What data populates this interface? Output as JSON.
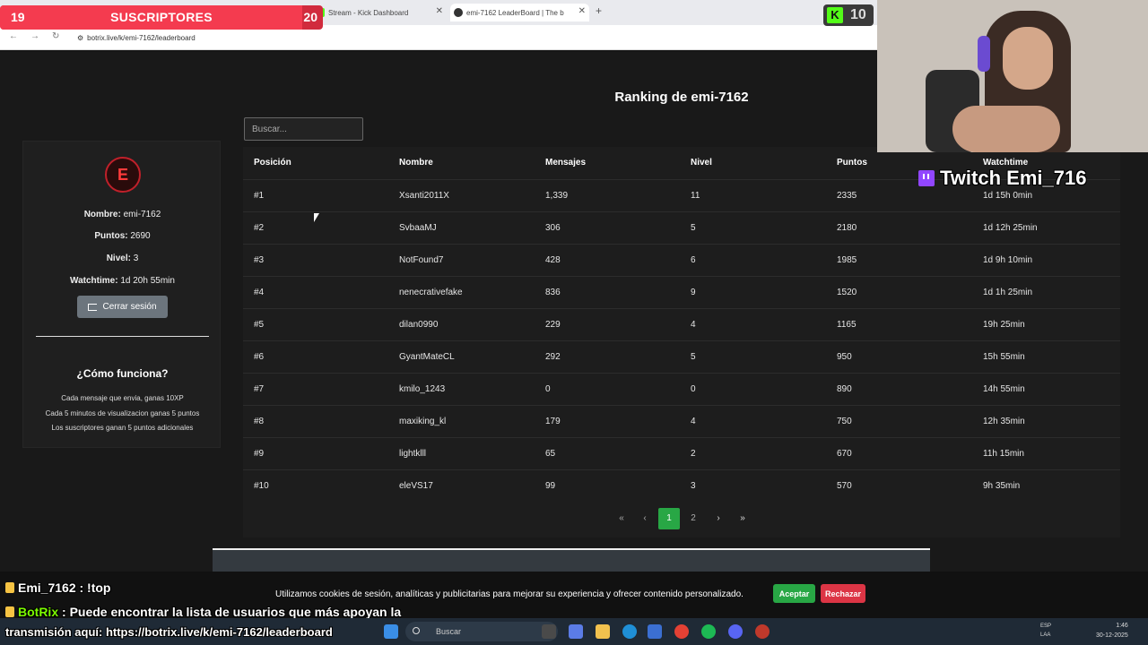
{
  "browser": {
    "tabs": [
      {
        "label": "Stream - Kick Dashboard"
      },
      {
        "label": "emi-7162 LeaderBoard | The b"
      }
    ],
    "url": "botrix.live/k/emi-7162/leaderboard",
    "new_tab": "+"
  },
  "overlay": {
    "subs_left": "19",
    "subs_title": "SUSCRIPTORES",
    "subs_right": "20",
    "kick_letter": "K",
    "kick_count": "10",
    "twitch_label": "Twitch Emi_716"
  },
  "page": {
    "title": "Ranking de emi-7162",
    "search_placeholder": "Buscar..."
  },
  "profile": {
    "avatar_letter": "E",
    "name_label": "Nombre:",
    "name_value": "emi-7162",
    "points_label": "Puntos:",
    "points_value": "2690",
    "level_label": "Nivel:",
    "level_value": "3",
    "watch_label": "Watchtime:",
    "watch_value": "1d 20h 55min",
    "logout_label": "Cerrar sesión",
    "how_title": "¿Cómo funciona?",
    "how_lines": [
      "Cada mensaje que envia, ganas 10XP",
      "Cada 5 minutos de visualizacion ganas 5 puntos",
      "Los suscriptores ganan 5 puntos adicionales"
    ]
  },
  "table": {
    "headers": [
      "Posición",
      "Nombre",
      "Mensajes",
      "Nivel",
      "Puntos",
      "Watchtime"
    ],
    "rows": [
      [
        "#1",
        "Xsanti2011X",
        "1,339",
        "11",
        "2335",
        "1d 15h 0min"
      ],
      [
        "#2",
        "SvbaaMJ",
        "306",
        "5",
        "2180",
        "1d 12h 25min"
      ],
      [
        "#3",
        "NotFound7",
        "428",
        "6",
        "1985",
        "1d 9h 10min"
      ],
      [
        "#4",
        "nenecrativefake",
        "836",
        "9",
        "1520",
        "1d 1h 25min"
      ],
      [
        "#5",
        "dilan0990",
        "229",
        "4",
        "1165",
        "19h 25min"
      ],
      [
        "#6",
        "GyantMateCL",
        "292",
        "5",
        "950",
        "15h 55min"
      ],
      [
        "#7",
        "kmilo_1243",
        "0",
        "0",
        "890",
        "14h 55min"
      ],
      [
        "#8",
        "maxiking_kl",
        "179",
        "4",
        "750",
        "12h 35min"
      ],
      [
        "#9",
        "lightklll",
        "65",
        "2",
        "670",
        "11h 15min"
      ],
      [
        "#10",
        "eleVS17",
        "99",
        "3",
        "570",
        "9h 35min"
      ]
    ]
  },
  "pager": {
    "first": "«",
    "prev": "‹",
    "pages": [
      "1",
      "2"
    ],
    "active": "1",
    "next": "›",
    "last": "»"
  },
  "cookie": {
    "text": "Utilizamos cookies de sesión, analíticas y publicitarias para mejorar su experiencia y ofrecer contenido personalizado.",
    "accept": "Aceptar",
    "reject": "Rechazar"
  },
  "chat": {
    "line1_name": "Emi_7162",
    "line1_text": ": !top",
    "line2_name": "BotRix",
    "line2_text": ": Puede encontrar la lista de usuarios que más apoyan la",
    "line3_text": "transmisión aquí: https://botrix.live/k/emi-7162/leaderboard"
  },
  "taskbar": {
    "search": "Buscar",
    "lang": "ESP",
    "lang2": "LAA",
    "time": "1:46",
    "date": "30-12-2025"
  },
  "colors": {
    "accent_green": "#28a745",
    "reject_red": "#dc3545",
    "kick_green": "#53fc18",
    "twitch_purple": "#9146ff"
  }
}
